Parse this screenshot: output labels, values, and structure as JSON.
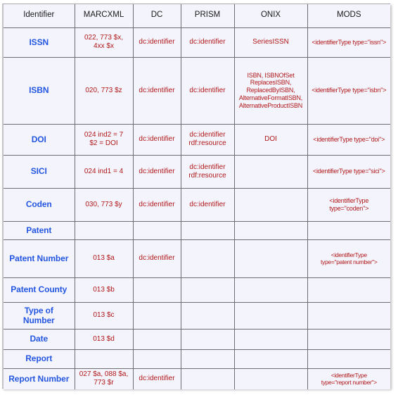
{
  "table": {
    "headers": [
      "Identifier",
      "MARCXML",
      "DC",
      "PRISM",
      "ONIX",
      "MODS"
    ],
    "rows": [
      {
        "identifier": "ISSN",
        "marcxml": [
          "022, 773 $x,",
          "4xx $x"
        ],
        "dc": "dc:identifier",
        "prism": [
          "dc:identifier"
        ],
        "onix": [
          "SeriesISSN"
        ],
        "mods": [
          "<identifierType type=\"issn\">"
        ]
      },
      {
        "identifier": "ISBN",
        "marcxml": [
          "020, 773 $z"
        ],
        "dc": "dc:identifier",
        "prism": [
          "dc:identifier"
        ],
        "onix": [
          "ISBN, ISBNOfSet",
          "ReplacesISBN,",
          "ReplacedByISBN,",
          "AlternativeFormatISBN,",
          "AlternativeProductISBN"
        ],
        "mods": [
          "<identifierType type=\"isbn\">"
        ]
      },
      {
        "identifier": "DOI",
        "marcxml": [
          "024 ind2 = 7",
          "$2 = DOI"
        ],
        "dc": "dc:identifier",
        "prism": [
          "dc:identifier",
          "rdf:resource"
        ],
        "onix": [
          "DOI"
        ],
        "mods": [
          "<identifierType type=\"doi\">"
        ]
      },
      {
        "identifier": "SICI",
        "marcxml": [
          "024 ind1 = 4"
        ],
        "dc": "dc:identifier",
        "prism": [
          "dc:identifier",
          "rdf:resource"
        ],
        "onix": [],
        "mods": [
          "<identifierType type=\"sici\">"
        ]
      },
      {
        "identifier": "Coden",
        "marcxml": [
          "030, 773 $y"
        ],
        "dc": "dc:identifier",
        "prism": [
          "dc:identifier"
        ],
        "onix": [],
        "mods": [
          "<identifierType type=\"coden\">"
        ]
      },
      {
        "identifier": "Patent",
        "marcxml": [],
        "dc": "",
        "prism": [],
        "onix": [],
        "mods": []
      },
      {
        "identifier": "Patent Number",
        "marcxml": [
          "013 $a"
        ],
        "dc": "dc:identifier",
        "prism": [],
        "onix": [],
        "mods": [
          "<identifierType",
          "type=\"patent number\">"
        ]
      },
      {
        "identifier": "Patent County",
        "marcxml": [
          "013 $b"
        ],
        "dc": "",
        "prism": [],
        "onix": [],
        "mods": []
      },
      {
        "identifier": "Type of Number",
        "marcxml": [
          "013 $c"
        ],
        "dc": "",
        "prism": [],
        "onix": [],
        "mods": []
      },
      {
        "identifier": "Date",
        "marcxml": [
          "013 $d"
        ],
        "dc": "",
        "prism": [],
        "onix": [],
        "mods": []
      },
      {
        "identifier": "Report",
        "marcxml": [],
        "dc": "",
        "prism": [],
        "onix": [],
        "mods": []
      },
      {
        "identifier": "Report Number",
        "marcxml": [
          "027 $a, 088 $a,",
          "773 $r"
        ],
        "dc": "dc:identifier",
        "prism": [],
        "onix": [],
        "mods": [
          "<identifierType",
          "type=\"report number\">"
        ]
      }
    ]
  },
  "colors": {
    "identifier_text": "#2456e0",
    "value_text": "#b01818",
    "header_text": "#1a1a1a",
    "cell_background": "#f4f4fd",
    "grid_line": "#6d6d72"
  }
}
